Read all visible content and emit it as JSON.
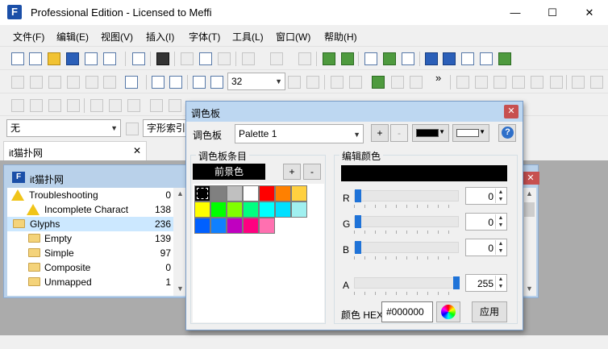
{
  "window": {
    "title": "Professional Edition - Licensed to Meffi",
    "logo_text": "F",
    "minimize_glyph": "—",
    "maximize_glyph": "☐",
    "close_glyph": "✕"
  },
  "menu": [
    "文件(F)",
    "编辑(E)",
    "视图(V)",
    "插入(I)",
    "字体(T)",
    "工具(L)",
    "窗口(W)",
    "帮助(H)"
  ],
  "toolbar": {
    "zoom_value": "32",
    "overflow_glyph": "»",
    "style_combo_value": "无",
    "glyph_index_label": "字形索引"
  },
  "document_tab": {
    "label": "it猫扑网",
    "close_glyph": "✕"
  },
  "font_window": {
    "title": "it猫扑网",
    "close_glyph": "✕",
    "tree": [
      {
        "icon": "warning",
        "indent": 0,
        "name": "Troubleshooting",
        "count": "0"
      },
      {
        "icon": "warning",
        "indent": 1,
        "name": "Incomplete Charact",
        "count": "138"
      },
      {
        "icon": "folder",
        "indent": 0,
        "name": "Glyphs",
        "count": "236",
        "selected": true
      },
      {
        "icon": "folder",
        "indent": 1,
        "name": "Empty",
        "count": "139"
      },
      {
        "icon": "folder",
        "indent": 1,
        "name": "Simple",
        "count": "97"
      },
      {
        "icon": "folder",
        "indent": 1,
        "name": "Composite",
        "count": "0"
      },
      {
        "icon": "folder",
        "indent": 1,
        "name": "Unmapped",
        "count": "1"
      }
    ]
  },
  "palette_dialog": {
    "title": "调色板",
    "close_glyph": "✕",
    "palette_label": "调色板",
    "palette_value": "Palette 1",
    "add_label": "+",
    "remove_label": "-",
    "help_glyph": "?",
    "fg_swatch_color": "#000000",
    "bg_swatch_color": "#ffffff",
    "entries_title": "调色板条目",
    "foreground_label": "前景色",
    "entries_add": "+",
    "entries_remove": "-",
    "swatches": [
      "#000000",
      "#808080",
      "#c0c0c0",
      "#ffffff",
      "#ff0000",
      "#ff8000",
      "#ffd040",
      "#ffff00",
      "#00ff00",
      "#80ff00",
      "#00ff80",
      "#00ffff",
      "#00e0ff",
      "#a0f0f0",
      "#0060ff",
      "#1080ff",
      "#c000c0",
      "#ff0080",
      "#ff70b0"
    ],
    "edit_title": "编辑颜色",
    "edit_color": "#000000",
    "channels": [
      {
        "label": "R",
        "value": "0",
        "level": 0
      },
      {
        "label": "G",
        "value": "0",
        "level": 0
      },
      {
        "label": "B",
        "value": "0",
        "level": 0
      },
      {
        "label": "A",
        "value": "255",
        "level": 1
      }
    ],
    "hex_label": "颜色 HEX",
    "hex_value": "#000000",
    "apply_label": "应用"
  },
  "colors": {
    "title_active": "#ffffff",
    "mdi_background": "#ababab",
    "selection": "#cce8ff",
    "accent_blue": "#1f73d8"
  }
}
